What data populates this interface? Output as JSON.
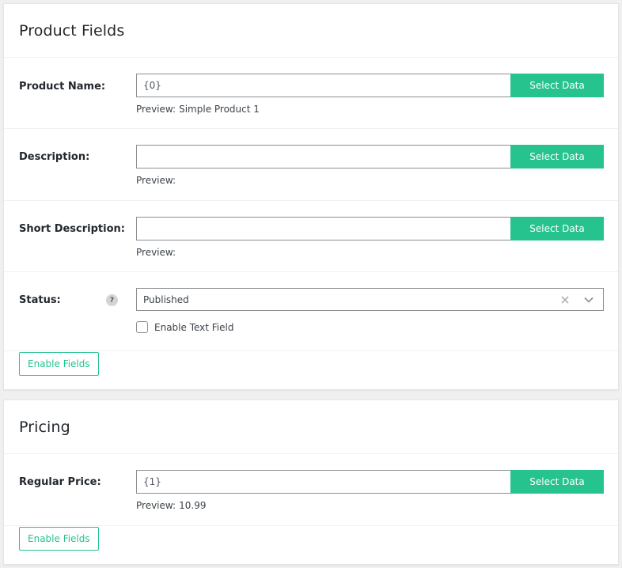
{
  "product_fields": {
    "title": "Product Fields",
    "rows": [
      {
        "label": "Product Name:",
        "value": "{0}",
        "button": "Select Data",
        "preview_label": "Preview:",
        "preview_value": "Simple Product 1"
      },
      {
        "label": "Description:",
        "value": "",
        "button": "Select Data",
        "preview_label": "Preview:",
        "preview_value": ""
      },
      {
        "label": "Short Description:",
        "value": "",
        "button": "Select Data",
        "preview_label": "Preview:",
        "preview_value": ""
      }
    ],
    "status": {
      "label": "Status:",
      "help_icon": "?",
      "selected": "Published",
      "checkbox_label": "Enable Text Field",
      "checked": false
    },
    "enable_button": "Enable Fields"
  },
  "pricing": {
    "title": "Pricing",
    "rows": [
      {
        "label": "Regular Price:",
        "value": "{1}",
        "button": "Select Data",
        "preview_label": "Preview:",
        "preview_value": "10.99"
      }
    ],
    "enable_button": "Enable Fields"
  },
  "colors": {
    "accent": "#26c38e",
    "border": "#8c8f94"
  }
}
